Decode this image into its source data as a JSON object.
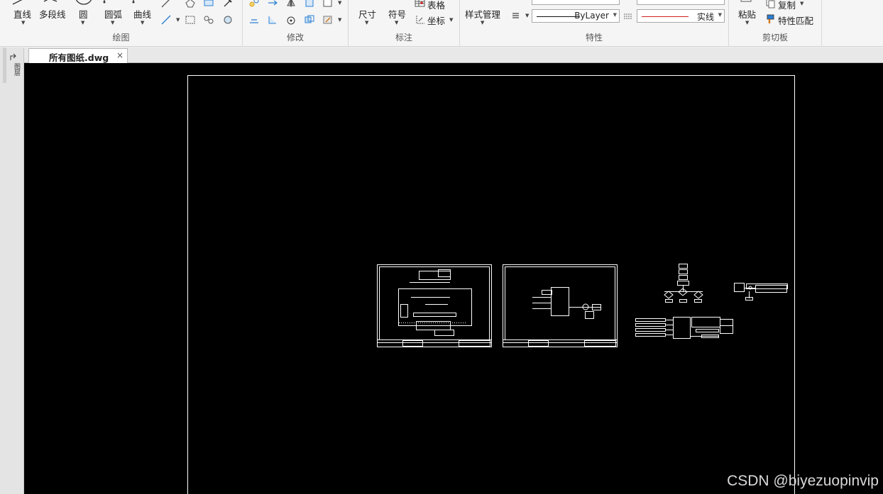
{
  "ribbon": {
    "draw": {
      "title": "绘图",
      "line": "直线",
      "polyline": "多段线",
      "circle": "圆",
      "arc": "圆弧",
      "curve": "曲线"
    },
    "modify": {
      "title": "修改"
    },
    "annotate": {
      "title": "标注",
      "dimension": "尺寸",
      "symbol": "符号",
      "table": "表格",
      "coordinate": "坐标"
    },
    "properties": {
      "title": "特性",
      "style_manager": "样式管理",
      "color_value": "ByLayer",
      "linetype_value": "实线"
    },
    "clipboard": {
      "title": "剪切板",
      "paste": "粘贴",
      "copy": "复制",
      "match_properties": "特性匹配"
    }
  },
  "document_tab": {
    "name": "所有图纸.dwg",
    "close": "×"
  },
  "side_palette": {
    "label": "图层"
  },
  "watermark": "CSDN @biyezuopinvip",
  "colors": {
    "canvas_bg": "#000000",
    "drawing_stroke": "#ffffff",
    "linetype_red": "#d02020"
  }
}
